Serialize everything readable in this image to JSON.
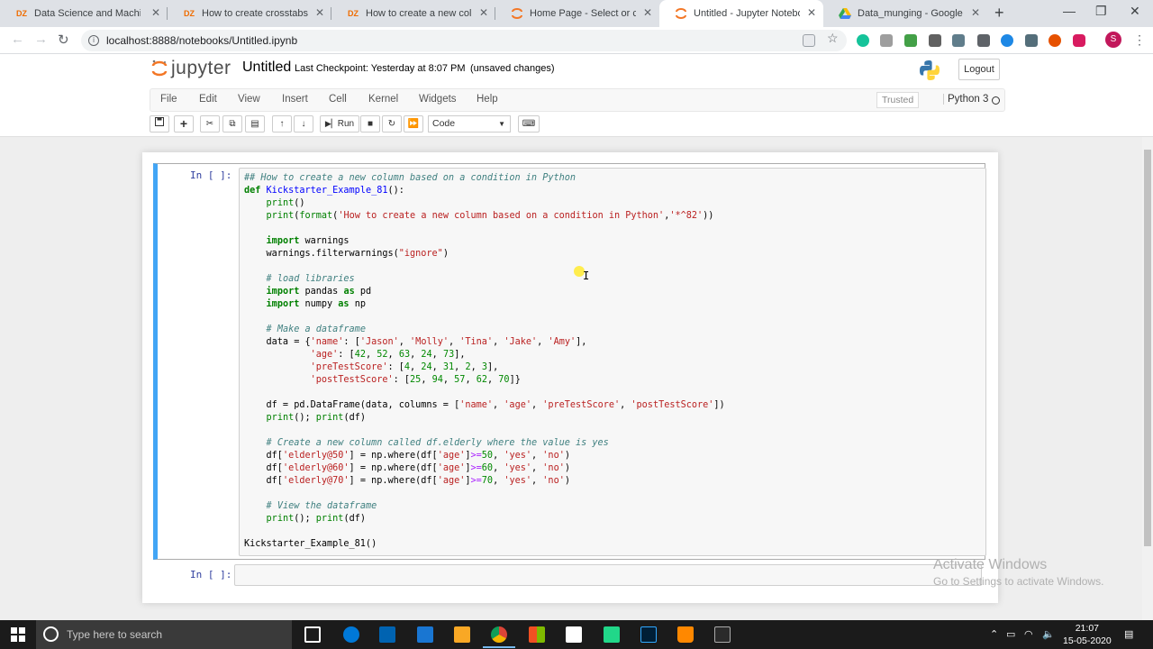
{
  "browser": {
    "tabs": [
      {
        "favicon": "DZ",
        "title": "Data Science and Machine Le",
        "active": false
      },
      {
        "favicon": "DZ",
        "title": "How to create crosstabs from",
        "active": false
      },
      {
        "favicon": "DZ",
        "title": "How to create a new column",
        "active": false
      },
      {
        "favicon": "jupyter-icon",
        "title": "Home Page - Select or create",
        "active": false
      },
      {
        "favicon": "jupyter-icon",
        "title": "Untitled - Jupyter Notebook",
        "active": true
      },
      {
        "favicon": "google-drive-icon",
        "title": "Data_munging - Google Drive",
        "active": false
      }
    ],
    "url": "localhost:8888/notebooks/Untitled.ipynb",
    "profile_initial": "S"
  },
  "jupyter": {
    "logo_text": "jupyter",
    "notebook_name": "Untitled",
    "checkpoint": "Last Checkpoint: Yesterday at 8:07 PM",
    "unsaved": "(unsaved changes)",
    "logout_label": "Logout",
    "menus": [
      "File",
      "Edit",
      "View",
      "Insert",
      "Cell",
      "Kernel",
      "Widgets",
      "Help"
    ],
    "trusted_label": "Trusted",
    "kernel_name": "Python 3",
    "run_label": "Run",
    "cell_type": "Code"
  },
  "cells": {
    "prompt_1": "In [ ]:",
    "prompt_2": "In [ ]:",
    "call_line": "Kickstarter_Example_81()"
  },
  "watermark": {
    "line1": "Activate Windows",
    "line2": "Go to Settings to activate Windows."
  },
  "taskbar": {
    "search_placeholder": "Type here to search",
    "time": "21:07",
    "date": "15-05-2020"
  },
  "colors": {
    "selected_cell_border": "#42a5f5",
    "prompt": "#303f9f",
    "comment": "#408080",
    "keyword": "#008000",
    "string": "#ba2121"
  }
}
